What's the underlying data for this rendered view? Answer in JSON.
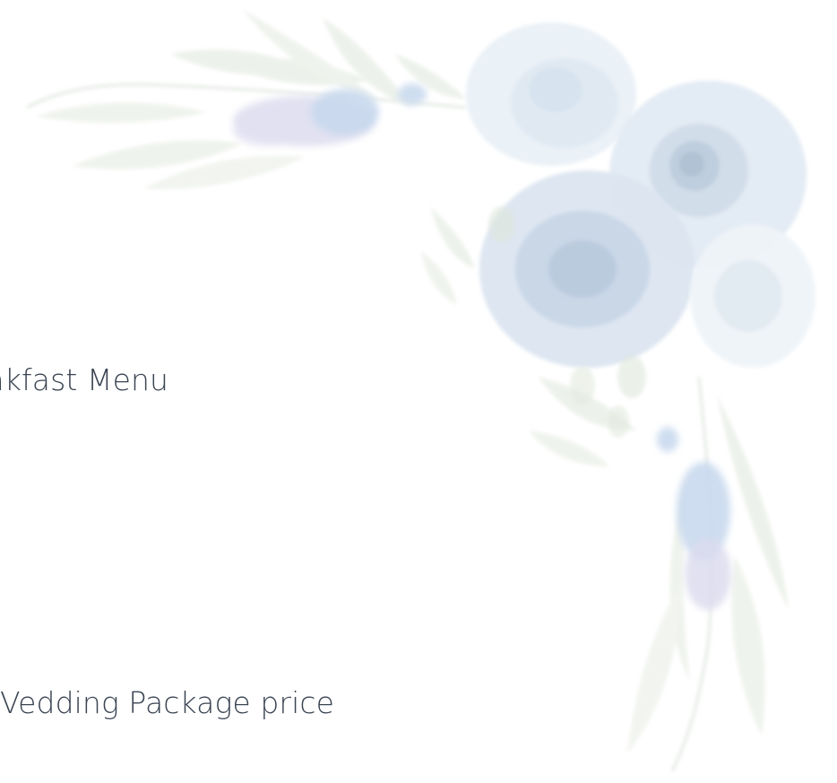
{
  "content": {
    "items": [
      {
        "label": "akfast Menu"
      },
      {
        "label": "Vedding Package price"
      }
    ]
  },
  "decoration": {
    "name": "watercolor-floral-corner",
    "colors": {
      "flower_main": "#d6e2ee",
      "flower_shadow": "#b9c9dc",
      "flower_light": "#e9f0f7",
      "leaf": "#dfe7dc",
      "leaf_dark": "#ccd8cc",
      "berry": "#c9d9ee",
      "lavender": "#dcdcef",
      "text": "#3a4452"
    }
  }
}
